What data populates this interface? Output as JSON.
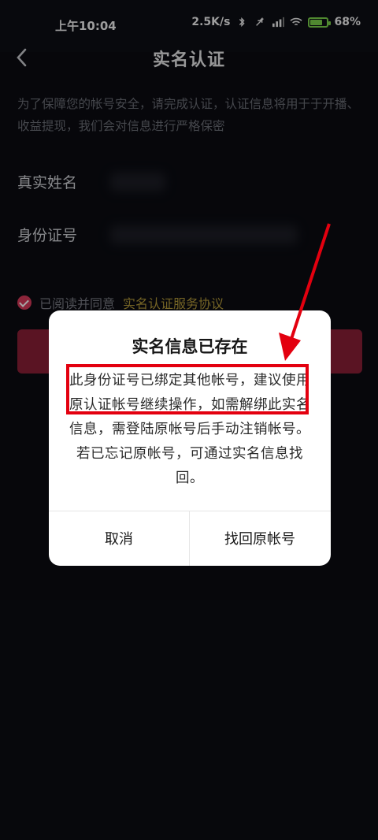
{
  "status_bar": {
    "time": "上午10:04",
    "network_speed": "2.5K/s",
    "battery": "68",
    "battery_level": 0.68,
    "icons": [
      "bluetooth-icon",
      "mute-icon",
      "hd-signal-icon",
      "wifi-icon",
      "battery-icon"
    ]
  },
  "header": {
    "title": "实名认证",
    "back_icon": "chevron-left-icon"
  },
  "page": {
    "description": "为了保障您的帐号安全，请完成认证，认证信息将用于于开播、收益提现，我们会对信息进行严格保密",
    "name_label": "真实姓名",
    "id_label": "身份证号",
    "agree_prefix": "已阅读并同意",
    "agree_link": "实名认证服务协议"
  },
  "dialog": {
    "title": "实名信息已存在",
    "body": "此身份证号已绑定其他帐号，建议使用原认证帐号继续操作，如需解绑此实名信息，需登陆原帐号后手动注销帐号。若已忘记原帐号，可通过实名信息找回。",
    "cancel_label": "取消",
    "confirm_label": "找回原帐号"
  },
  "colors": {
    "background": "#0b0c12",
    "accent": "#d83a5a",
    "link": "#b49a3a",
    "annotation": "#e3000f"
  }
}
